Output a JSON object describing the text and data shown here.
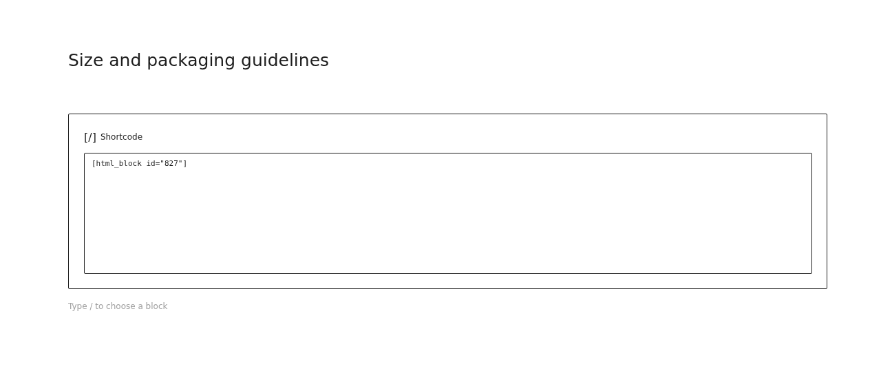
{
  "title": "Size and packaging guidelines",
  "block": {
    "icon": "[/]",
    "label": "Shortcode",
    "value": "[html_block id=\"827\"]"
  },
  "appender": {
    "placeholder": "Type / to choose a block"
  }
}
